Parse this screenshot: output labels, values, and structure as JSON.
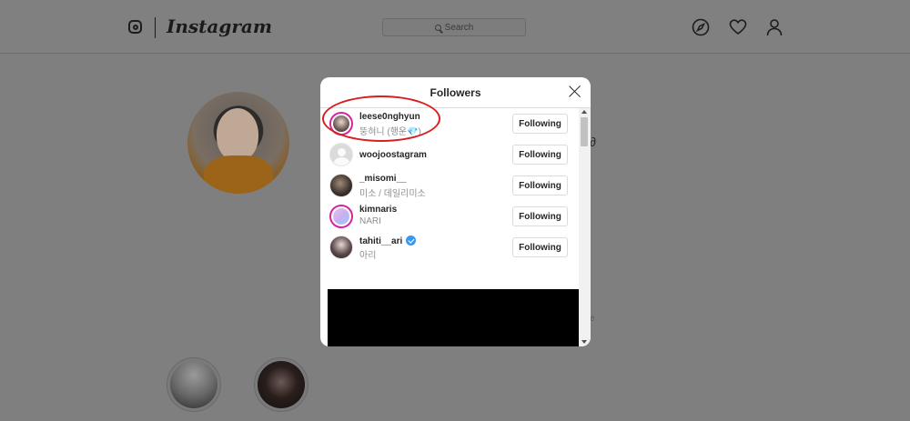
{
  "header": {
    "brand": "Instagram",
    "search_placeholder": "Search",
    "icons": [
      "explore-icon",
      "heart-icon",
      "profile-icon"
    ]
  },
  "modal": {
    "title": "Followers",
    "followers": [
      {
        "username": "leese0nghyun",
        "fullname": "뚱혀니 (행운💎)",
        "button": "Following",
        "story_ring": true
      },
      {
        "username": "woojoostagram",
        "fullname": "",
        "button": "Following",
        "story_ring": false
      },
      {
        "username": "_misomi__",
        "fullname": "미소 / 데일리미소",
        "button": "Following",
        "story_ring": false
      },
      {
        "username": "kimnaris",
        "fullname": "NARI",
        "button": "Following",
        "story_ring": true
      },
      {
        "username": "tahiti__ari",
        "fullname": "아리",
        "button": "Following",
        "story_ring": false,
        "verified": true
      }
    ]
  },
  "colors": {
    "overlay": "#7f7f7f",
    "annotation": "#d81e1e",
    "verified": "#3897f0"
  }
}
